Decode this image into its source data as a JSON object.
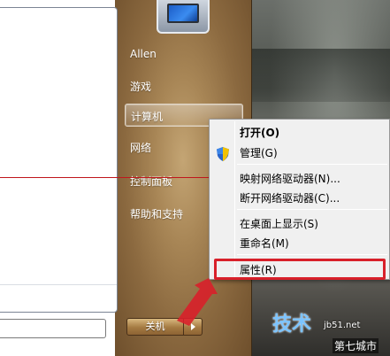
{
  "start_menu": {
    "right_items": [
      "Allen",
      "游戏",
      "计算机",
      "网络",
      "控制面板",
      "帮助和支持"
    ],
    "hovered_item": "计算机",
    "shutdown_label": "关机",
    "user_picture_icon": "monitor-icon"
  },
  "context_menu": {
    "items": [
      {
        "label": "打开(O)",
        "bold": true
      },
      {
        "label": "管理(G)",
        "icon": "uac-shield-icon"
      },
      {
        "label": "映射网络驱动器(N)..."
      },
      {
        "label": "断开网络驱动器(C)..."
      },
      {
        "label": "在桌面上显示(S)"
      },
      {
        "label": "重命名(M)"
      },
      {
        "label": "属性(R)",
        "highlighted": true
      }
    ]
  },
  "annotations": {
    "highlight_color": "#d8202a",
    "arrow_color": "#d8202a"
  },
  "watermark": {
    "logo_text": "技术",
    "site": "jb51.net",
    "brand": "第七城市"
  }
}
